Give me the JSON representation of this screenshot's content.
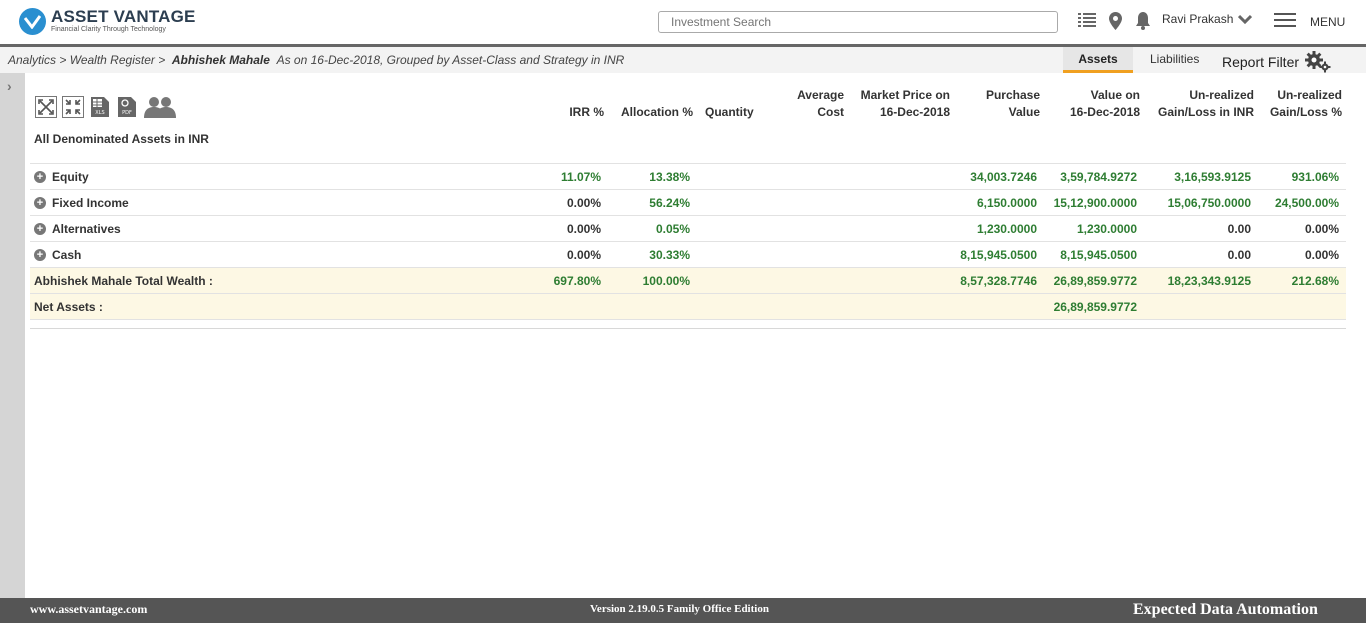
{
  "brand": {
    "name": "ASSET VANTAGE",
    "tagline": "Financial Clarity Through Technology",
    "logo_color": "#2a8fd0"
  },
  "header": {
    "search_placeholder": "Investment Search",
    "user_name": "Ravi Prakash",
    "menu_label": "MENU",
    "icons": [
      "list-icon",
      "location-pin-icon",
      "bell-icon",
      "chevron-down-icon",
      "hamburger-icon"
    ]
  },
  "breadcrumb": {
    "level1": "Analytics",
    "level2": "> Wealth Register >",
    "entity": "Abhishek Mahale",
    "context": "As on 16-Dec-2018, Grouped by Asset-Class and Strategy in INR"
  },
  "tabs": {
    "assets": "Assets",
    "liabilities": "Liabilities",
    "report_filter": "Report Filter"
  },
  "toolbar": [
    "expand-icon",
    "collapse-icon",
    "xls-export-icon",
    "pdf-export-icon",
    "group-users-icon"
  ],
  "table": {
    "columns": {
      "irr": "IRR %",
      "alloc": "Allocation %",
      "qty": "Quantity",
      "avg1": "Average",
      "avg2": "Cost",
      "mkt1": "Market Price on",
      "mkt2": "16-Dec-2018",
      "pur1": "Purchase",
      "pur2": "Value",
      "val1": "Value on",
      "val2": "16-Dec-2018",
      "ugl1": "Un-realized",
      "ugl2": "Gain/Loss in INR",
      "ugp1": "Un-realized",
      "ugp2": "Gain/Loss %"
    },
    "group_title": "All Denominated Assets in INR",
    "rows": [
      {
        "name": "Equity",
        "irr": "11.07%",
        "alloc": "13.38%",
        "purchase": "34,003.7246",
        "value": "3,59,784.9272",
        "gain": "3,16,593.9125",
        "gain_pct": "931.06%"
      },
      {
        "name": "Fixed Income",
        "irr": "0.00%",
        "alloc": "56.24%",
        "purchase": "6,150.0000",
        "value": "15,12,900.0000",
        "gain": "15,06,750.0000",
        "gain_pct": "24,500.00%"
      },
      {
        "name": "Alternatives",
        "irr": "0.00%",
        "alloc": "0.05%",
        "purchase": "1,230.0000",
        "value": "1,230.0000",
        "gain": "0.00",
        "gain_pct": "0.00%"
      },
      {
        "name": "Cash",
        "irr": "0.00%",
        "alloc": "30.33%",
        "purchase": "8,15,945.0500",
        "value": "8,15,945.0500",
        "gain": "0.00",
        "gain_pct": "0.00%"
      }
    ],
    "total": {
      "name": "Abhishek Mahale Total Wealth :",
      "irr": "697.80%",
      "alloc": "100.00%",
      "purchase": "8,57,328.7746",
      "value": "26,89,859.9772",
      "gain": "18,23,343.9125",
      "gain_pct": "212.68%"
    },
    "net": {
      "name": "Net Assets :",
      "value": "26,89,859.9772"
    }
  },
  "footer": {
    "website": "www.assetvantage.com",
    "version": "Version 2.19.0.5 Family Office Edition",
    "tagline": "Expected Data Automation"
  },
  "colors": {
    "positive": "#2e7d32",
    "accent": "#f0a020",
    "footer_bg": "#555555"
  }
}
